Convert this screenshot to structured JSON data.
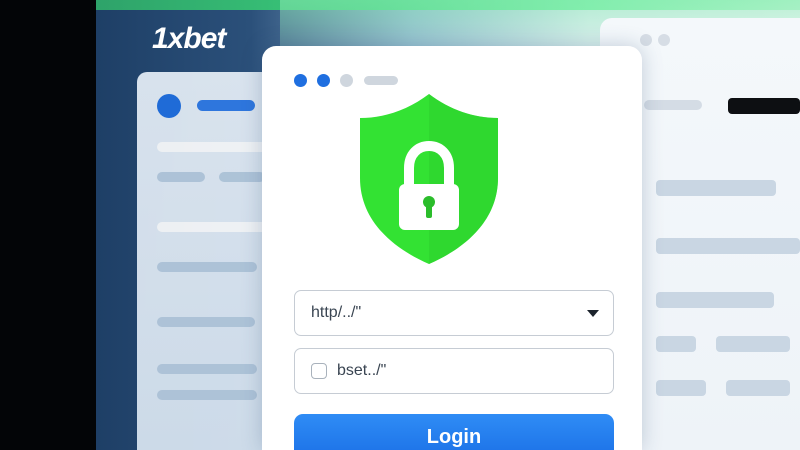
{
  "brand": {
    "logo_text": "1xbet"
  },
  "login_card": {
    "window_dots": [
      "#1f6fe0",
      "#1f6fe0",
      "#cfd6de"
    ],
    "shield": {
      "fill": "#33e233",
      "icon": "lock-icon"
    },
    "url_field": {
      "value": "http/../\"",
      "dropdown_icon": "chevron-down-icon"
    },
    "user_field": {
      "value": "bset../\"",
      "checked": false
    },
    "login_button": {
      "label": "Login",
      "color": "#1f78ee"
    }
  },
  "colors": {
    "accent_green": "#33e233",
    "accent_blue": "#1f78ee",
    "sidebar_dark": "#1e3f66"
  }
}
